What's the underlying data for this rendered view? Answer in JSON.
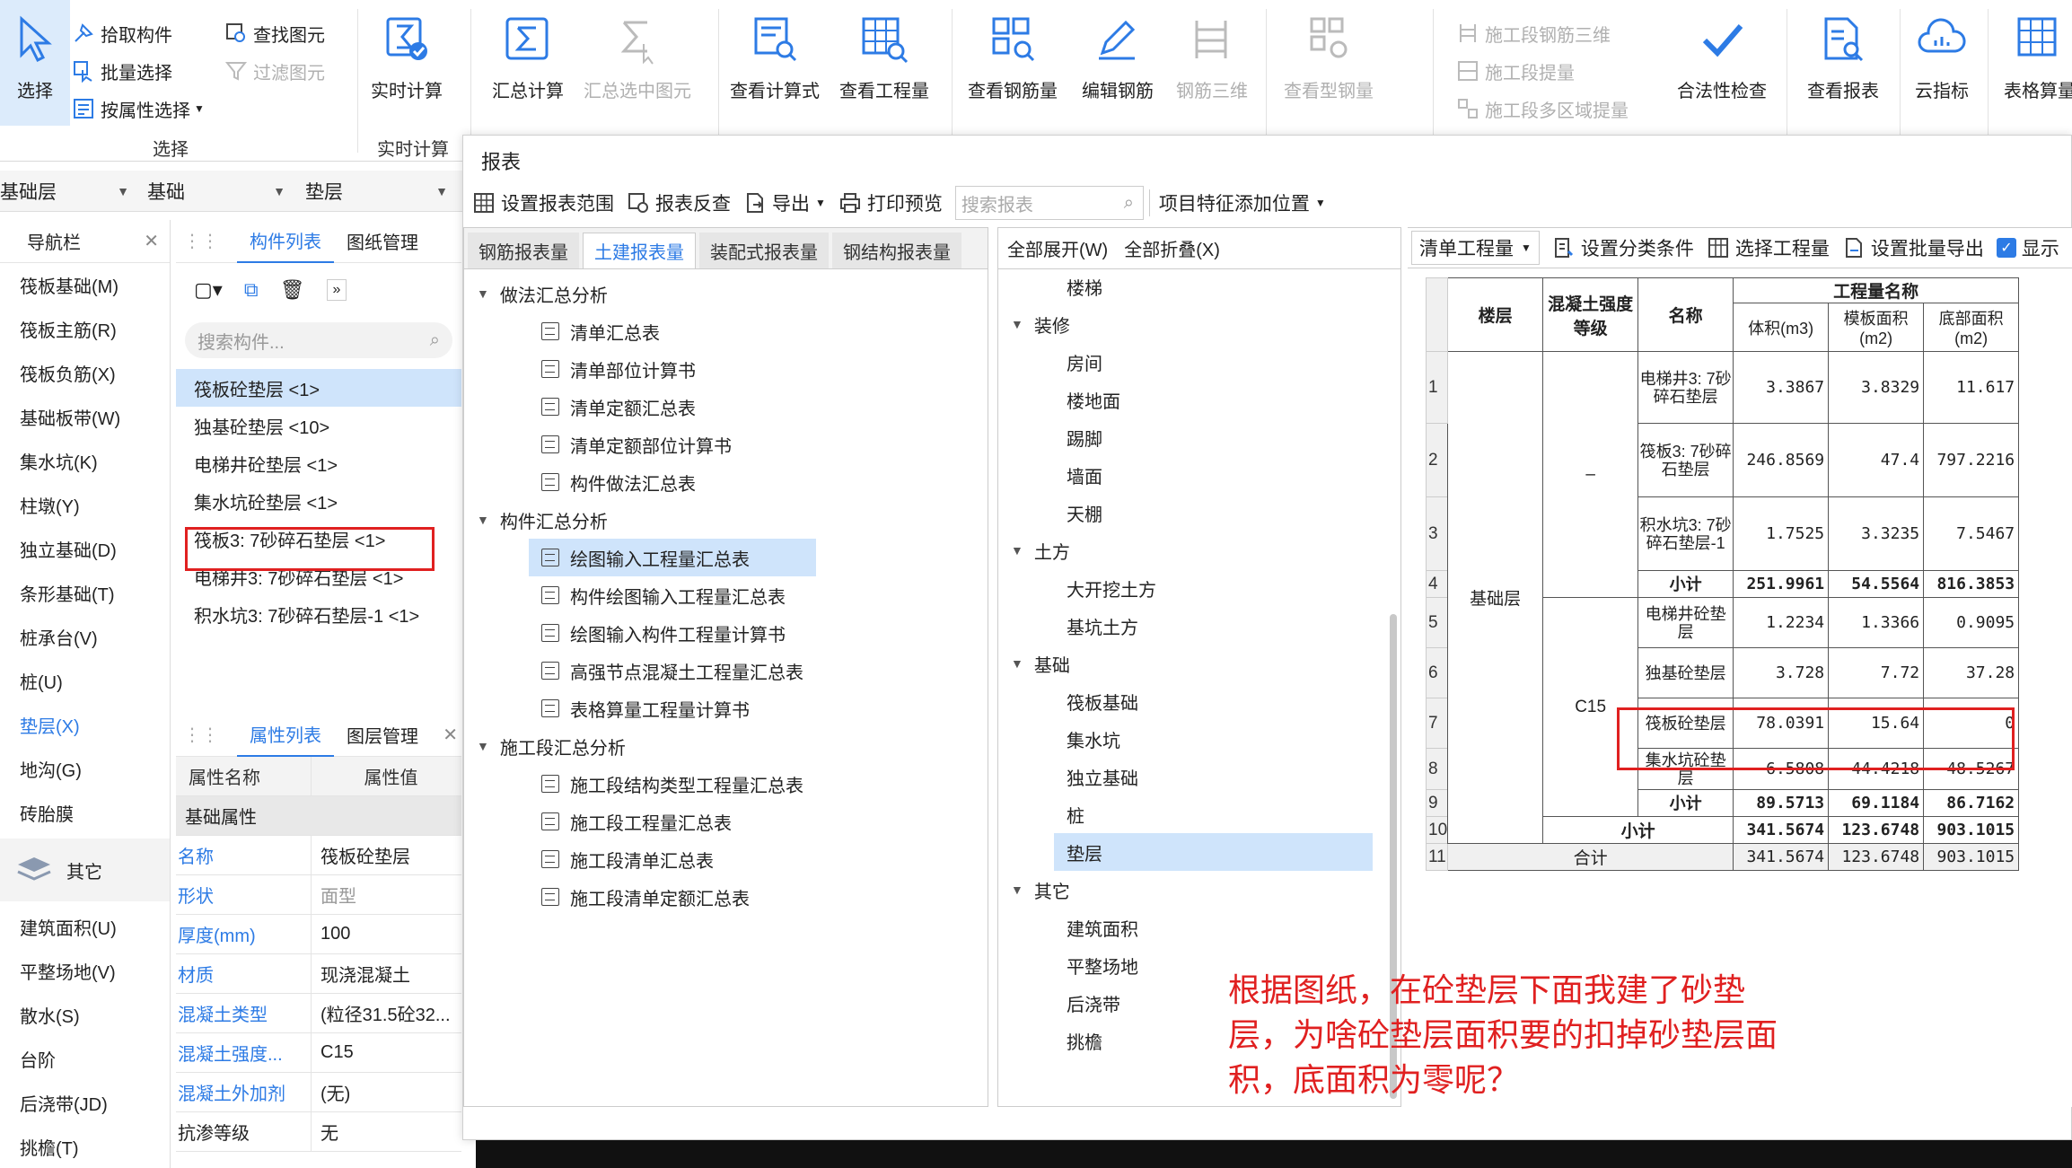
{
  "ribbon": {
    "select": "选择",
    "pick_component": "拾取构件",
    "batch_select": "批量选择",
    "by_property_select": "按属性选择",
    "find_element": "查找图元",
    "filter_element": "过滤图元",
    "group_select": "选择",
    "realtime_calc": "实时计算",
    "group_realtime": "实时计算",
    "summary_calc": "汇总计算",
    "summary_selected": "汇总选中图元",
    "view_formula": "查看计算式",
    "view_quantity": "查看工程量",
    "view_rebar": "查看钢筋量",
    "edit_rebar": "编辑钢筋",
    "rebar_3d": "钢筋三维",
    "view_steel": "查看型钢量",
    "stage_rebar_3d": "施工段钢筋三维",
    "stage_extract": "施工段提量",
    "stage_multi_extract": "施工段多区域提量",
    "legality_check": "合法性检查",
    "view_report": "查看报表",
    "cloud_index": "云指标",
    "table_calc": "表格算量"
  },
  "dropdowns": {
    "floor": "基础层",
    "category": "基础",
    "type": "垫层"
  },
  "nav": {
    "title": "导航栏",
    "items": [
      "筏板基础(M)",
      "筏板主筋(R)",
      "筏板负筋(X)",
      "基础板带(W)",
      "集水坑(K)",
      "柱墩(Y)",
      "独立基础(D)",
      "条形基础(T)",
      "桩承台(V)",
      "桩(U)",
      "垫层(X)",
      "地沟(G)",
      "砖胎膜"
    ],
    "group": "其它",
    "items2": [
      "建筑面积(U)",
      "平整场地(V)",
      "散水(S)",
      "台阶",
      "后浇带(JD)",
      "挑檐(T)"
    ]
  },
  "components": {
    "tab_list": "构件列表",
    "tab_drawing": "图纸管理",
    "search_placeholder": "搜索构件...",
    "items": [
      "筏板砼垫层 <1>",
      "独基砼垫层 <10>",
      "电梯井砼垫层 <1>",
      "集水坑砼垫层 <1>",
      "筏板3: 7砂碎石垫层 <1>",
      "电梯井3: 7砂碎石垫层 <1>",
      "积水坑3: 7砂碎石垫层-1 <1>"
    ]
  },
  "properties": {
    "tab_list": "属性列表",
    "tab_layer": "图层管理",
    "col_name": "属性名称",
    "col_value": "属性值",
    "section": "基础属性",
    "rows": [
      {
        "k": "名称",
        "v": "筏板砼垫层"
      },
      {
        "k": "形状",
        "v": "面型"
      },
      {
        "k": "厚度(mm)",
        "v": "100"
      },
      {
        "k": "材质",
        "v": "现浇混凝土"
      },
      {
        "k": "混凝土类型",
        "v": "(粒径31.5砼32..."
      },
      {
        "k": "混凝土强度...",
        "v": "C15"
      },
      {
        "k": "混凝土外加剂",
        "v": "(无)"
      },
      {
        "k": "抗渗等级",
        "v": "无"
      }
    ]
  },
  "dialog": {
    "title": "报表",
    "toolbar": {
      "set_range": "设置报表范围",
      "reverse_check": "报表反查",
      "export": "导出",
      "print_preview": "打印预览",
      "search_placeholder": "搜索报表",
      "feature_pos": "项目特征添加位置"
    },
    "tabs": [
      "钢筋报表量",
      "土建报表量",
      "装配式报表量",
      "钢结构报表量"
    ],
    "tree": [
      {
        "g": "做法汇总分析",
        "items": [
          "清单汇总表",
          "清单部位计算书",
          "清单定额汇总表",
          "清单定额部位计算书",
          "构件做法汇总表"
        ]
      },
      {
        "g": "构件汇总分析",
        "items": [
          "绘图输入工程量汇总表",
          "构件绘图输入工程量汇总表",
          "绘图输入构件工程量计算书",
          "高强节点混凝土工程量汇总表",
          "表格算量工程量计算书"
        ]
      },
      {
        "g": "施工段汇总分析",
        "items": [
          "施工段结构类型工程量汇总表",
          "施工段工程量汇总表",
          "施工段清单汇总表",
          "施工段清单定额汇总表"
        ]
      }
    ],
    "expand_all": "全部展开(W)",
    "collapse_all": "全部折叠(X)",
    "tree2": [
      {
        "l": "楼梯"
      },
      {
        "g": "装修"
      },
      {
        "l": "房间"
      },
      {
        "l": "楼地面"
      },
      {
        "l": "踢脚"
      },
      {
        "l": "墙面"
      },
      {
        "l": "天棚"
      },
      {
        "g": "土方"
      },
      {
        "l": "大开挖土方"
      },
      {
        "l": "基坑土方"
      },
      {
        "g": "基础"
      },
      {
        "l": "筏板基础"
      },
      {
        "l": "集水坑"
      },
      {
        "l": "独立基础"
      },
      {
        "l": "桩"
      },
      {
        "l": "垫层"
      },
      {
        "g": "其它"
      },
      {
        "l": "建筑面积"
      },
      {
        "l": "平整场地"
      },
      {
        "l": "后浇带"
      },
      {
        "l": "挑檐"
      }
    ],
    "p3": {
      "qty_type": "清单工程量",
      "set_category": "设置分类条件",
      "select_qty": "选择工程量",
      "batch_export": "设置批量导出",
      "show": "显示"
    },
    "table": {
      "h_floor": "楼层",
      "h_grade": "混凝土强度等级",
      "h_name": "名称",
      "h_qty": "工程量名称",
      "h_vol": "体积(m3)",
      "h_form": "模板面积(m2)",
      "h_bottom": "底部面积(m2)",
      "floor": "基础层",
      "grade_dash": "–",
      "grade_c15": "C15",
      "rows": [
        {
          "n": "1",
          "name": "电梯井3: 7砂碎石垫层",
          "vol": "3.3867",
          "form": "3.8329",
          "bottom": "11.617"
        },
        {
          "n": "2",
          "name": "筏板3: 7砂碎石垫层",
          "vol": "246.8569",
          "form": "47.4",
          "bottom": "797.2216"
        },
        {
          "n": "3",
          "name": "积水坑3: 7砂碎石垫层-1",
          "vol": "1.7525",
          "form": "3.3235",
          "bottom": "7.5467"
        },
        {
          "n": "4",
          "name": "小计",
          "vol": "251.9961",
          "form": "54.5564",
          "bottom": "816.3853"
        },
        {
          "n": "5",
          "name": "电梯井砼垫层",
          "vol": "1.2234",
          "form": "1.3366",
          "bottom": "0.9095"
        },
        {
          "n": "6",
          "name": "独基砼垫层",
          "vol": "3.728",
          "form": "7.72",
          "bottom": "37.28"
        },
        {
          "n": "7",
          "name": "筏板砼垫层",
          "vol": "78.0391",
          "form": "15.64",
          "bottom": "0"
        },
        {
          "n": "8",
          "name": "集水坑砼垫层",
          "vol": "6.5808",
          "form": "44.4218",
          "bottom": "48.5267"
        },
        {
          "n": "9",
          "name": "小计",
          "vol": "89.5713",
          "form": "69.1184",
          "bottom": "86.7162"
        },
        {
          "n": "10",
          "name": "小计",
          "vol": "341.5674",
          "form": "123.6748",
          "bottom": "903.1015"
        },
        {
          "n": "11",
          "name": "合计",
          "vol": "341.5674",
          "form": "123.6748",
          "bottom": "903.1015"
        }
      ]
    }
  },
  "annotation": "根据图纸，在砼垫层下面我建了砂垫层，为啥砼垫层面积要的扣掉砂垫层面积，底面积为零呢？"
}
